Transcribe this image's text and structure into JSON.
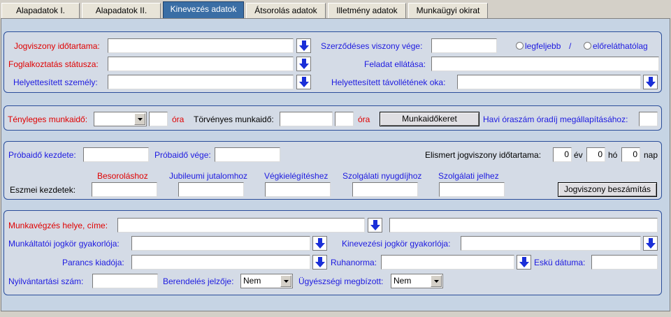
{
  "tabs": [
    {
      "label": "Alapadatok I."
    },
    {
      "label": "Alapadatok II."
    },
    {
      "label": "Kinevezés adatok"
    },
    {
      "label": "Átsorolás adatok"
    },
    {
      "label": "Illetmény adatok"
    },
    {
      "label": "Munkaügyi okirat"
    }
  ],
  "active_tab": "Kinevezés adatok",
  "colors": {
    "required_label": "#e00000",
    "optional_label": "#1d1ae0",
    "active_tab": "#3a6ea5"
  },
  "group1": {
    "jogviszony_idotartama": "Jogviszony időtartama:",
    "szerzodeses_viszony_vege": "Szerződéses viszony vége:",
    "radio_legfeljebb": "legfeljebb",
    "radio_separator": "/",
    "radio_elorelathatolag": "előreláthatólag",
    "foglalkoztatas_statusza": "Foglalkoztatás státusza:",
    "feladat_ellatasa": "Feladat ellátása:",
    "helyettesitett_szemely": "Helyettesített személy:",
    "helyettesitett_tavollet_oka": "Helyettesített távollétének oka:"
  },
  "group2": {
    "tenyleges_munkaido": "Tényleges munkaidő:",
    "ora1": "óra",
    "torvenyes_munkaido": "Törvényes munkaidő:",
    "ora2": "óra",
    "munkaidokeret_button": "Munkaidőkeret",
    "havi_oraszam": "Havi óraszám óradíj megállapításához:"
  },
  "group3": {
    "probaido_kezdete": "Próbaidő kezdete:",
    "probaido_vege": "Próbaidő vége:",
    "elismert_jogviszony": "Elismert jogviszony időtartama:",
    "ev_value": "0",
    "ev_label": "év",
    "ho_value": "0",
    "ho_label": "hó",
    "nap_value": "0",
    "nap_label": "nap",
    "besorolashoz": "Besoroláshoz",
    "jubileumi_jutalomhoz": "Jubileumi jutalomhoz",
    "vegkielegiteshez": "Végkielégítéshez",
    "szolgalati_nyugdijhoz": "Szolgálati nyugdíjhoz",
    "szolgalati_jelhez": "Szolgálati jelhez",
    "eszmei_kezdetek": "Eszmei kezdetek:",
    "jogviszony_beszamitas_button": "Jogviszony beszámítás"
  },
  "group4": {
    "munkavegzes_helye": "Munkavégzés helye, címe:",
    "munkaltatoi_jogkor": "Munkáltatói jogkör gyakorlója:",
    "kinevezesi_jogkor": "Kinevezési jogkör gyakorlója:",
    "parancs_kiadoja": "Parancs kiadója:",
    "ruhanorma": "Ruhanorma:",
    "esku_datuma": "Eskü dátuma:",
    "nyilvantartasi_szam": "Nyilvántartási szám:",
    "berendeles_jelzoje": "Berendelés jelzője:",
    "berendeles_value": "Nem",
    "ugyeszsegi_megbizott": "Ügyészségi megbízott:",
    "ugyeszsegi_value": "Nem"
  }
}
